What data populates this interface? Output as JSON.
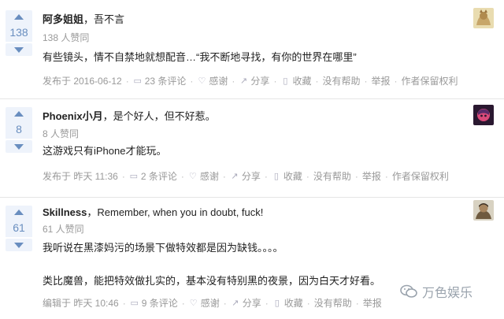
{
  "answers": [
    {
      "votes": "138",
      "author": "阿多姐姐",
      "bio": "，吾不言",
      "likes": "138 人赞同",
      "content": [
        "有些镜头，情不自禁地就想配音…“我不断地寻找，有你的世界在哪里”"
      ],
      "meta": {
        "date": "发布于 2016-06-12",
        "comments": "23 条评论",
        "thanks": "感谢",
        "share": "分享",
        "collect": "收藏",
        "unhelpful": "没有帮助",
        "report": "举报",
        "rights": "作者保留权利"
      }
    },
    {
      "votes": "8",
      "author": "Phoenix小月",
      "bio": "，是个好人，但不好惹。",
      "likes": "8 人赞同",
      "content": [
        "这游戏只有iPhone才能玩。"
      ],
      "meta": {
        "date": "发布于 昨天 11:36",
        "comments": "2 条评论",
        "thanks": "感谢",
        "share": "分享",
        "collect": "收藏",
        "unhelpful": "没有帮助",
        "report": "举报",
        "rights": "作者保留权利"
      }
    },
    {
      "votes": "61",
      "author": "Skillness",
      "bio": "，Remember, when you in doubt, fuck!",
      "likes": "61 人赞同",
      "content": [
        "我听说在黑漆妈污的场景下做特效都是因为缺钱。。。。",
        "类比魔兽，能把特效做扎实的，基本没有特别黑的夜景，因为白天才好看。"
      ],
      "meta": {
        "date": "编辑于 昨天 10:46",
        "comments": "9 条评论",
        "thanks": "感谢",
        "share": "分享",
        "collect": "收藏",
        "unhelpful": "没有帮助",
        "report": "举报"
      }
    }
  ],
  "watermark": "万色娱乐",
  "icons": {
    "comment": "comment-icon",
    "thanks": "heart-icon",
    "share": "share-icon",
    "collect": "bookmark-icon",
    "upvote": "triangle-up-icon",
    "downvote": "triangle-down-icon"
  },
  "colors": {
    "vote_bg": "#eef3fb",
    "vote_fg": "#698ebf",
    "meta": "#999999",
    "text": "#222222"
  }
}
